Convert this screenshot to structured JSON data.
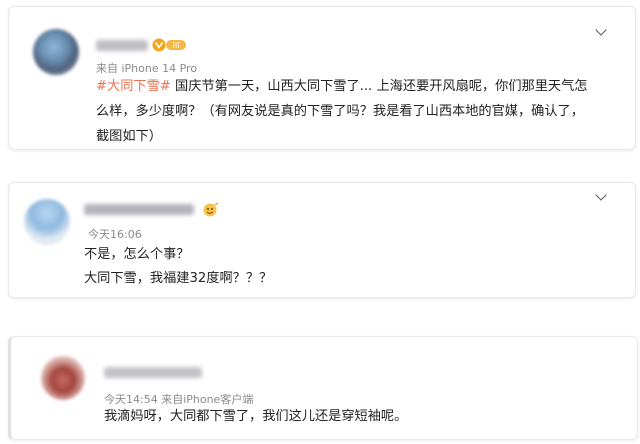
{
  "post": {
    "meta": "来自 iPhone 14 Pro",
    "hashtag": "#大同下雪#",
    "body": " 国庆节第一天，山西大同下雪了... 上海还要开风扇呢，你们那里天气怎么样，多少度啊？（有网友说是真的下雪了吗？我是看了山西本地的官媒，确认了，截图如下）"
  },
  "comment1": {
    "meta": "今天16:06",
    "line1": "不是，怎么个事？",
    "line2": "大同下雪，我福建32度啊？？？"
  },
  "comment2": {
    "meta": "今天14:54 来自iPhone客户端",
    "text": "我滴妈呀，大同都下雪了，我们这儿还是穿短袖呢。"
  },
  "icons": {
    "chevron": "chevron-down-icon",
    "vip_badge": "vip-badge-icon",
    "emoji": "emoji-icon"
  },
  "colors": {
    "hashtag": "#eb7350",
    "text": "#222222",
    "meta": "#8a8a8a",
    "badge": "#f3a51b"
  }
}
